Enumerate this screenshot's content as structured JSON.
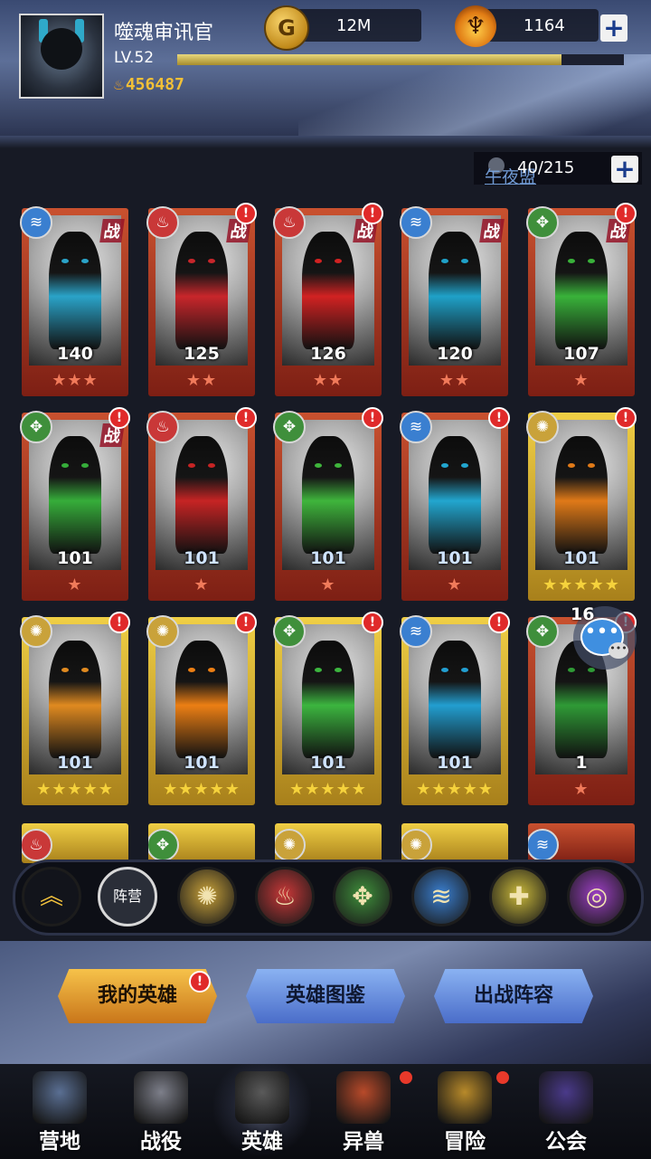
{
  "player": {
    "name": "噬魂审讯官",
    "level": "LV.52",
    "xp_fraction": 0.86,
    "power": "456487",
    "gold": "12M",
    "flame": "1164"
  },
  "roster": {
    "count": "40/215",
    "faded_label": "午夜盟"
  },
  "heroes": [
    {
      "level": "140",
      "stars": 3,
      "element": "water",
      "in_battle": true,
      "alert": false,
      "frame": "red",
      "body": "#2aa3c8"
    },
    {
      "level": "125",
      "stars": 2,
      "element": "fire",
      "in_battle": true,
      "alert": true,
      "frame": "red",
      "body": "#c8262b"
    },
    {
      "level": "126",
      "stars": 2,
      "element": "fire",
      "in_battle": true,
      "alert": true,
      "frame": "red",
      "body": "#d12222"
    },
    {
      "level": "120",
      "stars": 2,
      "element": "water",
      "in_battle": true,
      "alert": false,
      "frame": "red",
      "body": "#1fa1c8"
    },
    {
      "level": "107",
      "stars": 1,
      "element": "wood",
      "in_battle": true,
      "alert": true,
      "frame": "red",
      "body": "#39b23a"
    },
    {
      "level": "101",
      "stars": 1,
      "element": "wood",
      "in_battle": true,
      "alert": true,
      "frame": "red",
      "body": "#36ad3a"
    },
    {
      "level": "101",
      "stars": 1,
      "element": "fire",
      "in_battle": false,
      "alert": true,
      "frame": "red",
      "body": "#c62424"
    },
    {
      "level": "101",
      "stars": 1,
      "element": "wood",
      "in_battle": false,
      "alert": true,
      "frame": "red",
      "body": "#3fb53c"
    },
    {
      "level": "101",
      "stars": 1,
      "element": "water",
      "in_battle": false,
      "alert": true,
      "frame": "red",
      "body": "#22a6cf"
    },
    {
      "level": "101",
      "stars": 5,
      "element": "light",
      "in_battle": false,
      "alert": true,
      "frame": "gold",
      "body": "#e07a18"
    },
    {
      "level": "101",
      "stars": 5,
      "element": "light",
      "in_battle": false,
      "alert": true,
      "frame": "gold",
      "body": "#e08a20"
    },
    {
      "level": "101",
      "stars": 5,
      "element": "light",
      "in_battle": false,
      "alert": true,
      "frame": "gold",
      "body": "#ec7f14"
    },
    {
      "level": "101",
      "stars": 5,
      "element": "wood",
      "in_battle": false,
      "alert": true,
      "frame": "gold",
      "body": "#3cb53f"
    },
    {
      "level": "101",
      "stars": 5,
      "element": "water",
      "in_battle": false,
      "alert": true,
      "frame": "gold",
      "body": "#229ed0"
    },
    {
      "level": "1",
      "stars": 1,
      "element": "wood",
      "in_battle": false,
      "alert": true,
      "frame": "red",
      "body": "#2f9a36"
    }
  ],
  "chat": {
    "unread": "16"
  },
  "filters": {
    "collapse_icon": "chevron-up-icon",
    "camp_label": "阵营",
    "elements": [
      "light",
      "fire",
      "wood",
      "water",
      "holy",
      "void"
    ]
  },
  "actions": {
    "my_heroes": "我的英雄",
    "hero_codex": "英雄图鉴",
    "battle_lineup": "出战阵容"
  },
  "nav": [
    {
      "label": "营地",
      "icon": "castle-icon"
    },
    {
      "label": "战役",
      "icon": "crossed-swords-icon"
    },
    {
      "label": "英雄",
      "icon": "knight-helmet-icon"
    },
    {
      "label": "异兽",
      "icon": "beast-icon"
    },
    {
      "label": "冒险",
      "icon": "compass-icon"
    },
    {
      "label": "公会",
      "icon": "guild-banner-icon"
    }
  ],
  "element_colors": {
    "water": "#3a7fd0",
    "fire": "#c93838",
    "wood": "#3f8f3b",
    "light": "#c9a23a",
    "holy": "#c9b83a",
    "void": "#9b3fc2"
  }
}
